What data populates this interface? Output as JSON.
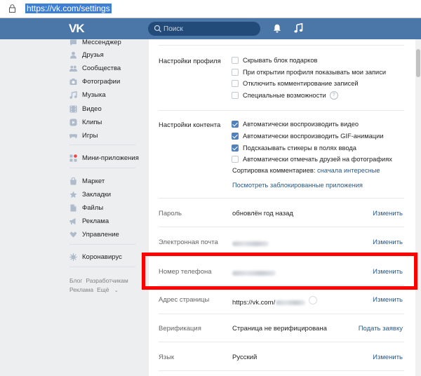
{
  "browser": {
    "url": "https://vk.com/settings"
  },
  "header": {
    "logo": "VK",
    "search_placeholder": "Поиск"
  },
  "sidebar": {
    "items": [
      {
        "label": "Мессенджер",
        "icon": "message-icon"
      },
      {
        "label": "Друзья",
        "icon": "friends-icon"
      },
      {
        "label": "Сообщества",
        "icon": "communities-icon"
      },
      {
        "label": "Фотографии",
        "icon": "photo-icon"
      },
      {
        "label": "Музыка",
        "icon": "music-icon"
      },
      {
        "label": "Видео",
        "icon": "video-icon"
      },
      {
        "label": "Клипы",
        "icon": "clips-icon"
      },
      {
        "label": "Игры",
        "icon": "games-icon"
      },
      {
        "label": "Мини-приложения",
        "icon": "mini-apps-icon"
      },
      {
        "label": "Маркет",
        "icon": "market-icon"
      },
      {
        "label": "Закладки",
        "icon": "bookmarks-icon"
      },
      {
        "label": "Файлы",
        "icon": "files-icon"
      },
      {
        "label": "Реклама",
        "icon": "ads-icon"
      },
      {
        "label": "Управление",
        "icon": "manage-icon"
      },
      {
        "label": "Коронавирус",
        "icon": "coronavirus-icon"
      }
    ],
    "footer": {
      "blog": "Блог",
      "developers": "Разработчикам",
      "ads": "Реклама",
      "more": "Ещё"
    }
  },
  "settings": {
    "profile": {
      "label": "Настройки профиля",
      "options": [
        {
          "label": "Скрывать блок подарков",
          "checked": false
        },
        {
          "label": "При открытии профиля показывать мои записи",
          "checked": false
        },
        {
          "label": "Отключить комментирование записей",
          "checked": false
        },
        {
          "label": "Специальные возможности",
          "checked": false,
          "help": "?"
        }
      ]
    },
    "content": {
      "label": "Настройки контента",
      "options": [
        {
          "label": "Автоматически воспроизводить видео",
          "checked": true
        },
        {
          "label": "Автоматически воспроизводить GIF-анимации",
          "checked": true
        },
        {
          "label": "Подсказывать стикеры в полях ввода",
          "checked": true
        },
        {
          "label": "Автоматически отмечать друзей на фотографиях",
          "checked": false
        }
      ],
      "sort_label": "Сортировка комментариев:",
      "sort_value": "сначала интересные",
      "blocked_apps": "Посмотреть заблокированные приложения"
    },
    "rows": {
      "password": {
        "label": "Пароль",
        "value": "обновлён год назад",
        "action": "Изменить"
      },
      "email": {
        "label": "Электронная почта",
        "action": "Изменить"
      },
      "phone": {
        "label": "Номер телефона",
        "action": "Изменить"
      },
      "address": {
        "label": "Адрес страницы",
        "value": "https://vk.com/",
        "action": "Изменить"
      },
      "verification": {
        "label": "Верификация",
        "value": "Страница не верифицирована",
        "action": "Подать заявку"
      },
      "language": {
        "label": "Язык",
        "value": "Русский",
        "action": "Изменить"
      }
    }
  },
  "colors": {
    "header": "#4a76a8",
    "accent": "#5181b8",
    "link": "#2a5885",
    "highlight": "#ff0000"
  }
}
